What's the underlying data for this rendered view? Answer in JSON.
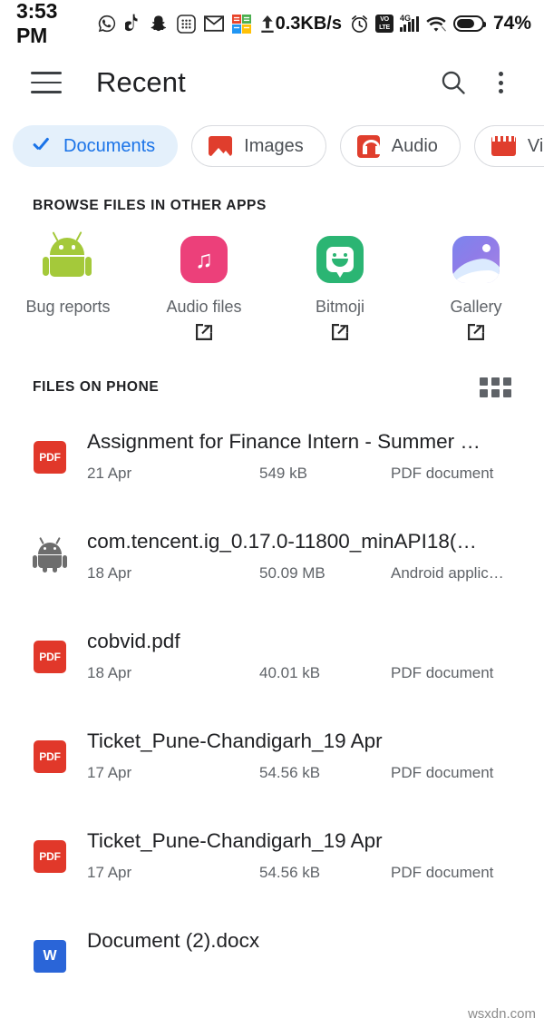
{
  "status_bar": {
    "time": "3:53 PM",
    "left_icons": [
      "whatsapp-icon",
      "tiktok-icon",
      "snapchat-icon",
      "keypad-icon",
      "gmail-icon",
      "msoffice-icon",
      "upload-icon"
    ],
    "network_speed": "0.3KB/s",
    "right_icons": [
      "alarm-icon",
      "volte-icon",
      "signal-4g-icon",
      "wifi-icon",
      "battery-icon"
    ],
    "volte_top": "VO",
    "volte_bottom": "LTE",
    "network_gen": "4G",
    "battery_percent": "74%"
  },
  "app_bar": {
    "menu_icon": "hamburger-menu-icon",
    "title": "Recent",
    "search_icon": "search-icon",
    "overflow_icon": "more-vertical-icon"
  },
  "filter_chips": [
    {
      "label": "Documents",
      "icon": "check-icon",
      "selected": true
    },
    {
      "label": "Images",
      "icon": "image-icon",
      "selected": false
    },
    {
      "label": "Audio",
      "icon": "headphones-icon",
      "selected": false
    },
    {
      "label": "Vi",
      "icon": "video-clapper-icon",
      "selected": false
    }
  ],
  "browse_section": {
    "title": "BROWSE FILES IN OTHER APPS",
    "apps": [
      {
        "name": "Bug reports",
        "icon": "android-robot-icon",
        "external": false
      },
      {
        "name": "Audio files",
        "icon": "music-note-icon",
        "external": true
      },
      {
        "name": "Bitmoji",
        "icon": "bitmoji-face-icon",
        "external": true
      },
      {
        "name": "Gallery",
        "icon": "gallery-photo-icon",
        "external": true
      }
    ]
  },
  "files_section": {
    "title": "FILES ON PHONE",
    "view_toggle_icon": "grid-view-icon",
    "rows": [
      {
        "name": "Assignment for Finance Intern - Summer …",
        "date": "21 Apr",
        "size": "549 kB",
        "type": "PDF document",
        "icon": "pdf-file-icon",
        "badge": "PDF"
      },
      {
        "name": "com.tencent.ig_0.17.0-11800_minAPI18(…",
        "date": "18 Apr",
        "size": "50.09 MB",
        "type": "Android applic…",
        "icon": "apk-file-icon",
        "badge": ""
      },
      {
        "name": "cobvid.pdf",
        "date": "18 Apr",
        "size": "40.01 kB",
        "type": "PDF document",
        "icon": "pdf-file-icon",
        "badge": "PDF"
      },
      {
        "name": "Ticket_Pune-Chandigarh_19 Apr",
        "date": "17 Apr",
        "size": "54.56 kB",
        "type": "PDF document",
        "icon": "pdf-file-icon",
        "badge": "PDF"
      },
      {
        "name": "Ticket_Pune-Chandigarh_19 Apr",
        "date": "17 Apr",
        "size": "54.56 kB",
        "type": "PDF document",
        "icon": "pdf-file-icon",
        "badge": "PDF"
      },
      {
        "name": "Document (2).docx",
        "date": "",
        "size": "",
        "type": "",
        "icon": "word-file-icon",
        "badge": "W"
      }
    ]
  },
  "watermark": "wsxdn.com",
  "colors": {
    "accent_blue": "#1a73e8",
    "chip_selected_bg": "#e4f0fb",
    "pdf_red": "#e1382a",
    "word_blue": "#2a65d8",
    "text_primary": "#202124",
    "text_secondary": "#5f6368"
  }
}
